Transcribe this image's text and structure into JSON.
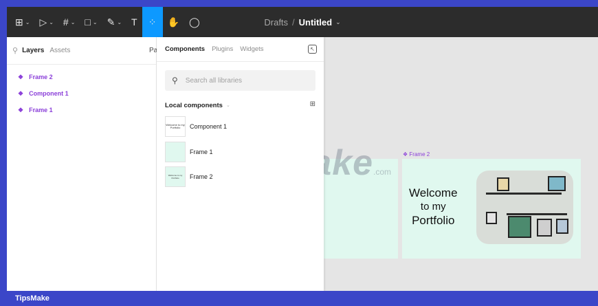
{
  "toolbar": {
    "tools": [
      {
        "glyph": "⊞",
        "name": "main-menu"
      },
      {
        "glyph": "▷",
        "name": "move-tool"
      },
      {
        "glyph": "#",
        "name": "frame-tool"
      },
      {
        "glyph": "□",
        "name": "shape-tool"
      },
      {
        "glyph": "✎",
        "name": "pen-tool"
      },
      {
        "glyph": "T",
        "name": "text-tool"
      }
    ],
    "chevron": "⌄",
    "resources_glyph": "⁘",
    "hand_glyph": "✋",
    "comment_glyph": "◯"
  },
  "header": {
    "drafts": "Drafts",
    "separator": "/",
    "file_name": "Untitled",
    "chevron": "⌄"
  },
  "left_panel": {
    "search_glyph": "⚲",
    "tabs": {
      "layers": "Layers",
      "assets": "Assets"
    },
    "page_label": "Pa",
    "layers": [
      {
        "label": "Frame 2",
        "glyph": "❖"
      },
      {
        "label": "Component 1",
        "glyph": "❖"
      },
      {
        "label": "Frame 1",
        "glyph": "❖"
      }
    ]
  },
  "components_panel": {
    "tabs": {
      "components": "Components",
      "plugins": "Plugins",
      "widgets": "Widgets"
    },
    "close_glyph": "↖",
    "search": {
      "glyph": "⚲",
      "placeholder": "Search all libraries"
    },
    "local_heading": "Local components",
    "local_chevron": "⌄",
    "grid_glyph": "⊞",
    "items": [
      {
        "label": "Component 1",
        "thumb_text": "Welcome to my Portfolio"
      },
      {
        "label": "Frame 1",
        "thumb_text": ""
      },
      {
        "label": "Frame 2",
        "thumb_text": "Welcome to my Portfolio"
      }
    ]
  },
  "canvas": {
    "frame2_label": "Frame 2",
    "frame2_glyph": "❖",
    "welcome_line1": "Welcome",
    "welcome_line2": "to my",
    "welcome_line3": "Portfolio",
    "frame_bg": "#e0f8ef"
  },
  "watermark": {
    "text": "TipsMake",
    "suffix": ".com"
  },
  "footer": {
    "text": "TipsMake"
  },
  "colors": {
    "accent": "#0d99ff",
    "component_purple": "#8b3fd9",
    "toolbar_bg": "#2c2c2c",
    "border_blue": "#3b46c8"
  }
}
